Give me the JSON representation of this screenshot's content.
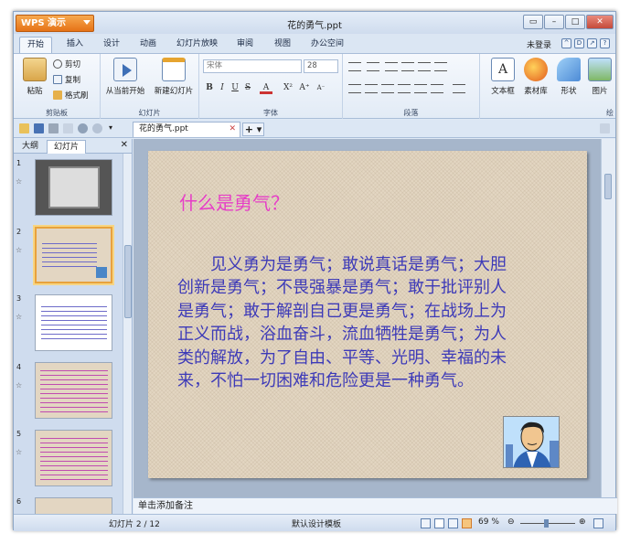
{
  "app": {
    "button_label": "WPS 演示",
    "title": "花的勇气.ppt",
    "login": "未登录"
  },
  "menu": [
    "开始",
    "插入",
    "设计",
    "动画",
    "幻灯片放映",
    "审阅",
    "视图",
    "办公空间"
  ],
  "ribbon": {
    "paste": "粘贴",
    "cut": "剪切",
    "copy": "复制",
    "format_painter": "格式刷",
    "clipboard": "剪贴板",
    "from_current": "从当前开始",
    "new_slide": "新建幻灯片",
    "slides_group": "幻灯片",
    "font_name": "宋体",
    "font_size": "28",
    "font_group": "字体",
    "para_group": "段落",
    "textbox": "文本框",
    "material": "素材库",
    "shape": "形状",
    "picture": "图片",
    "draw_group": "绘"
  },
  "doc_tab": "花的勇气.ppt",
  "sidepanel": {
    "tabs": [
      "大纲",
      "幻灯片"
    ],
    "thumb_nums": [
      "1",
      "2",
      "3",
      "4",
      "5",
      "6"
    ]
  },
  "slide": {
    "title": "什么是勇气？",
    "body": "见义勇为是勇气；敢说真话是勇气；大胆创新是勇气；不畏强暴是勇气；敢于批评别人是勇气；敢于解剖自己更是勇气；在战场上为正义而战，浴血奋斗，流血牺牲是勇气；为人类的解放，为了自由、平等、光明、幸福的未来，不怕一切困难和危险更是一种勇气。"
  },
  "notes": "单击添加备注",
  "status": {
    "slide_count": "幻灯片 2 / 12",
    "template": "默认设计模板",
    "zoom": "69 %"
  },
  "colors": {
    "accent": "#e67217",
    "title": "#e63ec7",
    "body": "#3d3ab8"
  }
}
